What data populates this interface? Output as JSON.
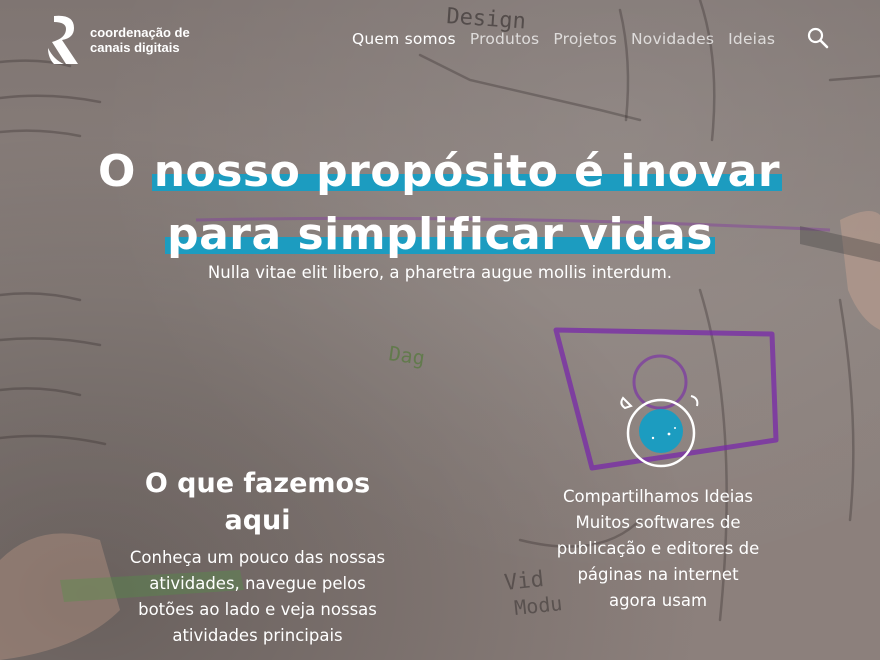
{
  "header": {
    "logo_line1": "coordenação de",
    "logo_line2": "canais digitais",
    "nav": [
      {
        "label": "Quem somos"
      },
      {
        "label": "Produtos"
      },
      {
        "label": "Projetos"
      },
      {
        "label": "Novidades"
      },
      {
        "label": "Ideias"
      }
    ]
  },
  "hero": {
    "line1_plain": "O ",
    "line1_highlight": "nosso propósito é inovar",
    "line2_highlight": "para simplificar vidas",
    "subtitle": "Nulla vitae elit libero, a pharetra augue mollis interdum."
  },
  "what_we_do": {
    "title_line1": "O que fazemos",
    "title_line2": "aqui",
    "description": "Conheça um pouco das nossas atividades, navegue pelos botões ao lado e veja nossas atividades principais"
  },
  "feature": {
    "title": "Compartilhamos Ideias",
    "description": "Muitos softwares de publicação e editores de páginas na internet agora usam",
    "icon": "lightbulb-icon"
  },
  "background_sketch_words": [
    "Design",
    "Dag",
    "Vid",
    "Modu"
  ],
  "colors": {
    "accent": "#1c9cc0",
    "background": "#8a7f7b"
  }
}
